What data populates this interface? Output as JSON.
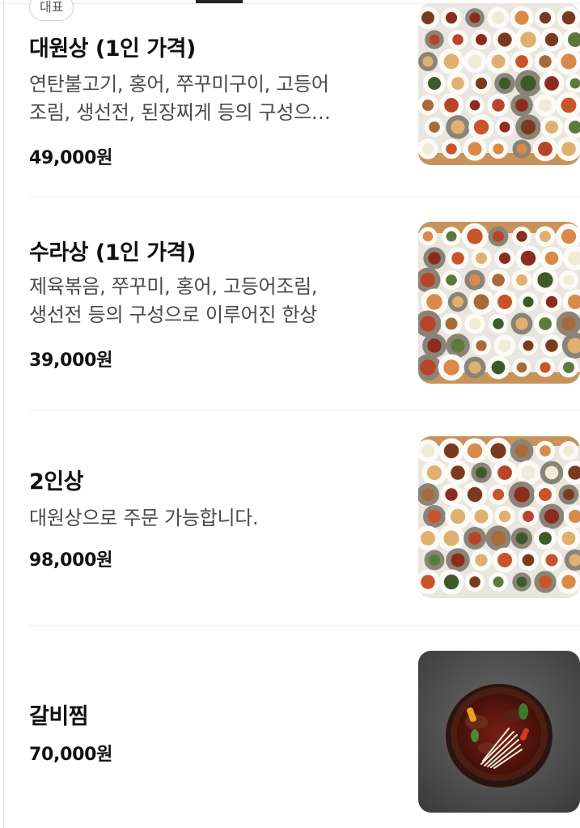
{
  "badge": "대표",
  "items": [
    {
      "name": "대원상 (1인 가격)",
      "desc1": "연탄불고기, 홍어, 쭈꾸미구이, 고등어",
      "desc2": "조림, 생선전, 된장찌게 등의 구성으…",
      "price": "49,000원"
    },
    {
      "name": "수라상 (1인 가격)",
      "desc1": "제육볶음, 쭈꾸미, 홍어, 고등어조림,",
      "desc2": "생선전 등의 구성으로 이루어진 한상",
      "price": "39,000원"
    },
    {
      "name": "2인상",
      "desc1": "대원상으로 주문 가능합니다.",
      "price": "98,000원"
    },
    {
      "name": "갈비찜",
      "price": "70,000원"
    }
  ]
}
